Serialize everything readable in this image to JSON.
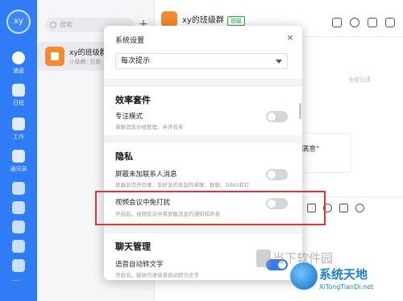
{
  "rail": {
    "avatar_text": "xy",
    "items": [
      {
        "label": "消息"
      },
      {
        "label": "日程"
      },
      {
        "label": "工作"
      },
      {
        "label": "通讯录"
      }
    ]
  },
  "chat_list": {
    "search_placeholder": "搜索",
    "add_label": "+",
    "item": {
      "name": "xy的班级群",
      "preview": "小助教: 拉新"
    }
  },
  "chat": {
    "title": "xy的班级群",
    "badge": "班级",
    "timestamp": "全部已读",
    "quote": "\"满意\""
  },
  "dialog": {
    "title": "系统设置",
    "close": "×",
    "select_value": "每次提示",
    "sections": [
      {
        "title": "效率套件",
        "rows": [
          {
            "title": "专注模式",
            "desc": "单聊消息分组管理，并开有条",
            "on": false
          }
        ]
      },
      {
        "title": "隐私",
        "rows": [
          {
            "title": "屏蔽未加联系人消息",
            "desc": "屏蔽非目开同事、非好友的发起的单聊、群聊、DING和钉",
            "on": false
          },
          {
            "title": "视频会议中免打扰",
            "desc": "开启后，视频会议中将屏蔽消息的通知和声音",
            "on": false
          }
        ]
      },
      {
        "title": "聊天管理",
        "rows": [
          {
            "title": "语音自动转文字",
            "desc": "开启后，接收的语音将自动转为文字",
            "on": true
          }
        ]
      }
    ]
  },
  "watermark": {
    "line1": "当下软件园",
    "line2": "系统天地",
    "line3": "XiTongTianDi.net"
  }
}
